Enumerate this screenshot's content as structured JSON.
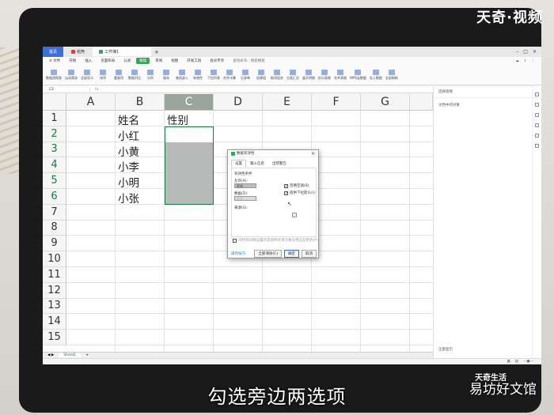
{
  "brand_watermark": "天奇·视频",
  "titlebar": {
    "home": "首页",
    "tabs": [
      "稻壳",
      "工作簿1"
    ],
    "plus": "+"
  },
  "menubar": {
    "file": "≡ 文件",
    "items": [
      "开始",
      "插入",
      "页面布局",
      "公式",
      "数据",
      "审阅",
      "视图",
      "开发工具",
      "会员专享"
    ],
    "active": "数据",
    "search": "查找命令、搜索模板"
  },
  "toolbar": {
    "tools": [
      "数据透视表",
      "自动筛选",
      "全部显示",
      "排序",
      "重复项",
      "数据对比",
      "分列",
      "填充",
      "查找录入",
      "有效性",
      "下拉列表",
      "合并计算",
      "记录单",
      "创建组",
      "取消组合",
      "分类汇总",
      "展开明细",
      "拆分表格",
      "合并表格",
      "WPS云数据",
      "导入数据",
      "全部刷新"
    ]
  },
  "formula_bar": {
    "name_box": "C2",
    "fx": "fx"
  },
  "columns": [
    "A",
    "B",
    "C",
    "D",
    "E",
    "F",
    "G"
  ],
  "rows": [
    "1",
    "2",
    "3",
    "4",
    "5",
    "6",
    "7",
    "8",
    "9",
    "10",
    "11",
    "12",
    "13",
    "14",
    "15"
  ],
  "cells": {
    "B1": "姓名",
    "C1": "性别",
    "B2": "小红",
    "B3": "小黄",
    "B4": "小李",
    "B5": "小明",
    "B6": "小张"
  },
  "sheet_tab": "Sheet1",
  "right_panel": {
    "title": "选择窗格",
    "subtitle": "文档中的对象",
    "footer": "全部显示"
  },
  "dialog": {
    "title": "数据有效性",
    "tabs": [
      "设置",
      "输入信息",
      "出错警告"
    ],
    "active_tab": "设置",
    "section": "有效性条件",
    "allow_label": "允许(A):",
    "allow_value": "序列",
    "data_label": "数据(D):",
    "data_value": "介于",
    "source_label": "来源(S):",
    "check_ignore_blank": "忽略空值(B)",
    "check_dropdown": "提供下拉箭头(I)",
    "apply_all": "对所有同样设置的其他所有单元格应用这些更改(P)",
    "tips": "操作技巧",
    "clear_button": "全部清除(C)",
    "ok_button": "确定",
    "cancel_button": "取消"
  },
  "subtitle": "勾选旁边两选项",
  "corner_watermark_top": "天奇生活",
  "corner_watermark": "易坊好文馆"
}
